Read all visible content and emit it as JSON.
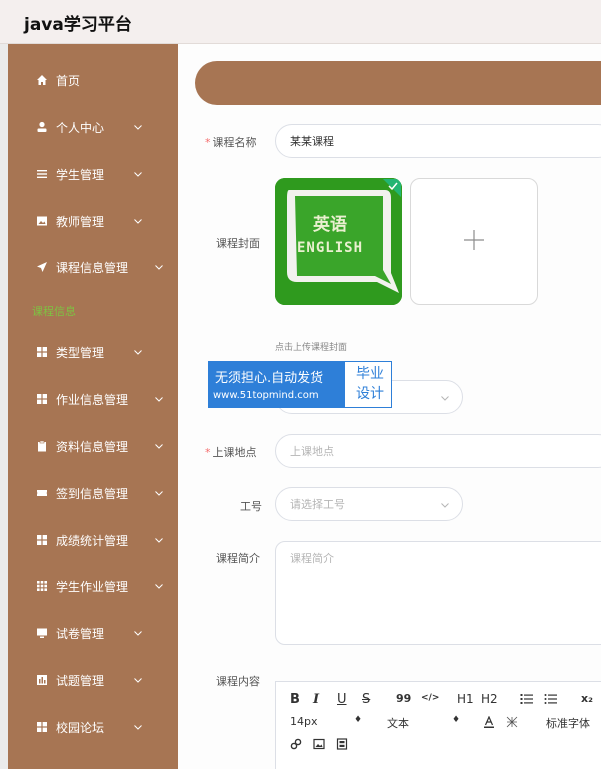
{
  "app": {
    "title": "java学习平台"
  },
  "sidebar": {
    "items": [
      {
        "label": "首页",
        "icon": "home-icon",
        "has_arrow": false
      },
      {
        "label": "个人中心",
        "icon": "user-icon",
        "has_arrow": true
      },
      {
        "label": "学生管理",
        "icon": "list-icon",
        "has_arrow": true
      },
      {
        "label": "教师管理",
        "icon": "image-icon",
        "has_arrow": true
      },
      {
        "label": "课程信息管理",
        "icon": "send-icon",
        "has_arrow": true
      },
      {
        "label": "类型管理",
        "icon": "grid-icon",
        "has_arrow": true
      },
      {
        "label": "作业信息管理",
        "icon": "grid-icon",
        "has_arrow": true
      },
      {
        "label": "资料信息管理",
        "icon": "clipboard-icon",
        "has_arrow": true
      },
      {
        "label": "签到信息管理",
        "icon": "ticket-icon",
        "has_arrow": true
      },
      {
        "label": "成绩统计管理",
        "icon": "grid-icon",
        "has_arrow": true
      },
      {
        "label": "学生作业管理",
        "icon": "dots-grid-icon",
        "has_arrow": true
      },
      {
        "label": "试卷管理",
        "icon": "monitor-icon",
        "has_arrow": true
      },
      {
        "label": "试题管理",
        "icon": "bar-chart-icon",
        "has_arrow": true
      },
      {
        "label": "校园论坛",
        "icon": "grid-icon",
        "has_arrow": true
      }
    ],
    "active_sub": "课程信息"
  },
  "form": {
    "course_name": {
      "label": "课程名称",
      "value": "某某课程",
      "required": true
    },
    "cover": {
      "label": "课程封面",
      "hint": "点击上传课程封面",
      "image_text_top": "英语",
      "image_text_bottom": "ENGLISH"
    },
    "location": {
      "label": "上课地点",
      "placeholder": "上课地点",
      "required": true
    },
    "job_no": {
      "label": "工号",
      "placeholder": "请选择工号"
    },
    "intro": {
      "label": "课程简介",
      "placeholder": "课程简介"
    },
    "content": {
      "label": "课程内容"
    }
  },
  "editor": {
    "toolbar": {
      "bold": "B",
      "italic": "I",
      "underline": "U",
      "strike": "S",
      "quote": "99",
      "code": "</>",
      "h1": "H1",
      "h2": "H2",
      "sub": "x₂",
      "font_size": "14px",
      "paragraph": "文本",
      "font_family": "标准字体",
      "stepper": "♦"
    }
  },
  "watermark": {
    "line1": "无须担心.自动发货",
    "line2": "www.51topmind.com",
    "right_top": "毕业",
    "right_bottom": "设计"
  },
  "colors": {
    "sidebar": "#a77553",
    "accent": "#7ec242",
    "required": "#f56c6c",
    "watermark": "#2e7fd8"
  }
}
